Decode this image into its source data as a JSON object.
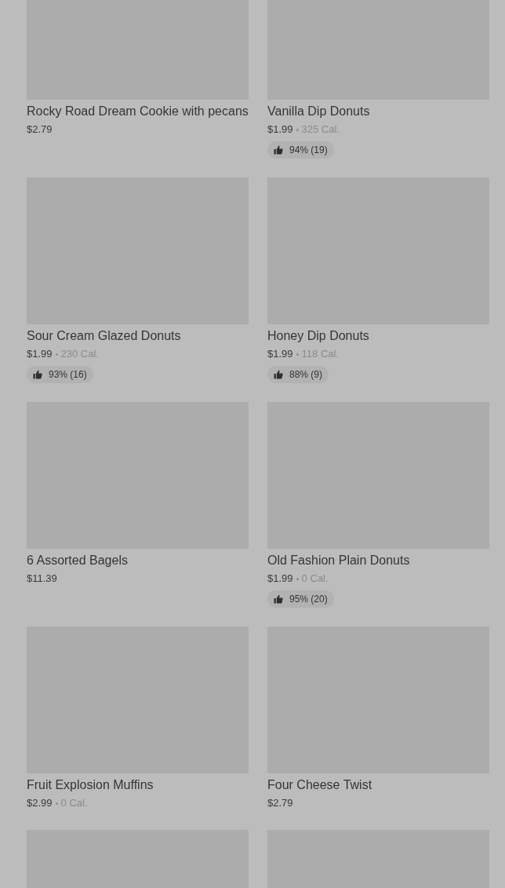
{
  "items": [
    {
      "kind": "product",
      "name": "Rocky Road Dream Cookie with pecans",
      "price": "$2.79"
    },
    {
      "kind": "product",
      "name": "Vanilla Dip Donuts",
      "price": "$1.99",
      "calories": "325 Cal.",
      "rating": "94% (19)"
    },
    {
      "kind": "product",
      "name": "Sour Cream Glazed Donuts",
      "price": "$1.99",
      "calories": "230 Cal.",
      "rating": "93% (16)"
    },
    {
      "kind": "product",
      "name": "Honey Dip Donuts",
      "price": "$1.99",
      "calories": "118 Cal.",
      "rating": "88% (9)"
    },
    {
      "kind": "product",
      "name": "6 Assorted Bagels",
      "price": "$11.39"
    },
    {
      "kind": "product",
      "name": "Old Fashion Plain Donuts",
      "price": "$1.99",
      "calories": "0 Cal.",
      "rating": "95% (20)"
    },
    {
      "kind": "product",
      "name": "Fruit Explosion Muffins",
      "price": "$2.99",
      "calories": "0 Cal."
    },
    {
      "kind": "product",
      "name": "Four Cheese Twist",
      "price": "$2.79"
    },
    {
      "kind": "image-only"
    },
    {
      "kind": "image-only"
    }
  ]
}
